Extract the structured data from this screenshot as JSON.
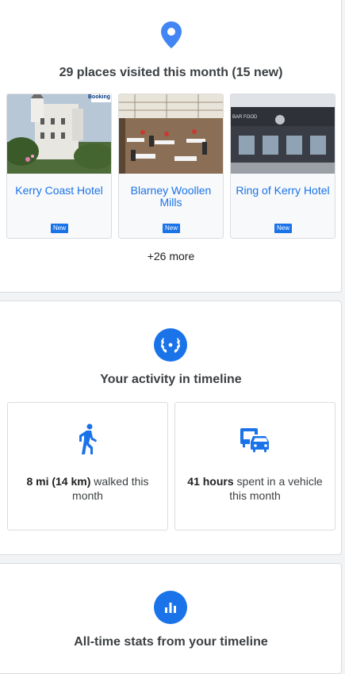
{
  "places": {
    "heading": "29 places visited this month (15 new)",
    "tiles": [
      {
        "name": "Kerry Coast Hotel",
        "badge": "New",
        "photo_label": "Booking"
      },
      {
        "name": "Blarney Woollen Mills",
        "badge": "New"
      },
      {
        "name": "Ring of Kerry Hotel",
        "badge": "New",
        "photo_label": "BAR FOOD"
      }
    ],
    "more": "+26 more",
    "icon": "location-pin-icon"
  },
  "activity": {
    "heading": "Your activity in timeline",
    "icon": "laurel-wreath-icon",
    "walking": {
      "value": "8 mi (14 km)",
      "suffix": " walked this month",
      "icon": "walking-person-icon"
    },
    "vehicle": {
      "value": "41 hours",
      "suffix": " spent in a vehicle this month",
      "icon": "vehicle-icon"
    }
  },
  "stats": {
    "heading": "All-time stats from your timeline",
    "icon": "bar-chart-icon"
  },
  "colors": {
    "accent": "#1a73e8",
    "badge": "#1a73e8",
    "border": "#dadce0"
  }
}
